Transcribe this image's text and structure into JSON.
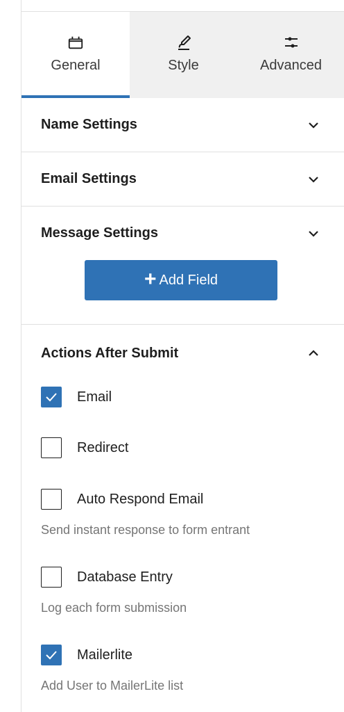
{
  "tabs": [
    {
      "label": "General",
      "icon": "block-icon",
      "active": true
    },
    {
      "label": "Style",
      "icon": "brush-icon",
      "active": false
    },
    {
      "label": "Advanced",
      "icon": "sliders-icon",
      "active": false
    }
  ],
  "sections": {
    "name": {
      "title": "Name Settings",
      "expanded": false
    },
    "email": {
      "title": "Email Settings",
      "expanded": false
    },
    "message": {
      "title": "Message Settings",
      "expanded": false
    },
    "actions": {
      "title": "Actions After Submit",
      "expanded": true
    }
  },
  "add_field": {
    "label": "Add Field"
  },
  "actions": [
    {
      "label": "Email",
      "checked": true,
      "help": ""
    },
    {
      "label": "Redirect",
      "checked": false,
      "help": ""
    },
    {
      "label": "Auto Respond Email",
      "checked": false,
      "help": "Send instant response to form entrant"
    },
    {
      "label": "Database Entry",
      "checked": false,
      "help": "Log each form submission"
    },
    {
      "label": "Mailerlite",
      "checked": true,
      "help": "Add User to MailerLite list"
    }
  ],
  "colors": {
    "accent": "#2f72b5",
    "tab_bg": "#f0f0f0",
    "border": "#e0e0e0",
    "help_text": "#757575"
  }
}
